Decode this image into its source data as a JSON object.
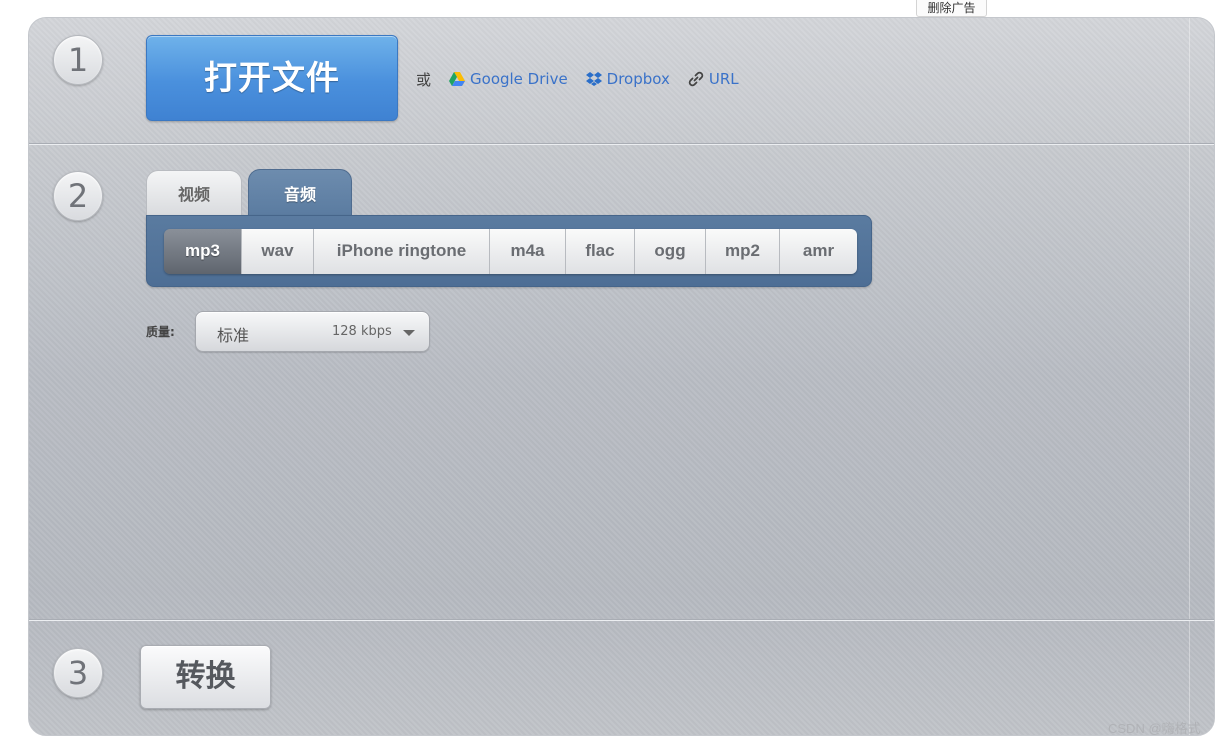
{
  "ad": {
    "remove_label": "删除广告"
  },
  "steps": {
    "one": "1",
    "two": "2",
    "three": "3"
  },
  "open": {
    "button_label": "打开文件",
    "or_label": "或",
    "sources": [
      {
        "label": "Google Drive",
        "icon": "google-drive-icon"
      },
      {
        "label": "Dropbox",
        "icon": "dropbox-icon"
      },
      {
        "label": "URL",
        "icon": "link-icon"
      }
    ]
  },
  "tabs": [
    {
      "label": "视频",
      "active": false
    },
    {
      "label": "音频",
      "active": true
    }
  ],
  "formats": [
    {
      "label": "mp3",
      "active": true
    },
    {
      "label": "wav",
      "active": false
    },
    {
      "label": "iPhone ringtone",
      "active": false
    },
    {
      "label": "m4a",
      "active": false
    },
    {
      "label": "flac",
      "active": false
    },
    {
      "label": "ogg",
      "active": false
    },
    {
      "label": "mp2",
      "active": false
    },
    {
      "label": "amr",
      "active": false
    }
  ],
  "quality": {
    "label": "质量:",
    "selected_name": "标准",
    "selected_rate": "128 kbps"
  },
  "convert": {
    "button_label": "转换"
  },
  "watermark": "CSDN @嗨格式",
  "colors": {
    "primary_blue": "#4a90dd",
    "link_blue": "#3a72c9",
    "tab_active": "#5a7ba0"
  }
}
